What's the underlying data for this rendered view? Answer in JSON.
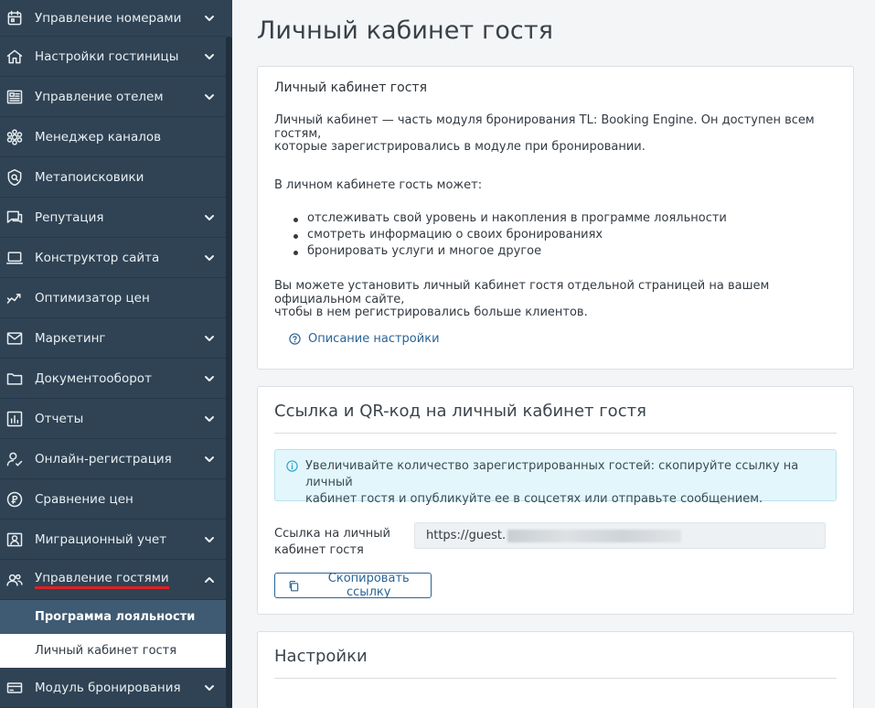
{
  "sidebar": {
    "items": [
      {
        "label": "Управление номерами",
        "icon": "calendar-icon"
      },
      {
        "label": "Настройки гостиницы",
        "icon": "home-icon"
      },
      {
        "label": "Управление отелем",
        "icon": "dashboard-icon"
      },
      {
        "label": "Менеджер каналов",
        "icon": "channels-icon"
      },
      {
        "label": "Метапоисковики",
        "icon": "search-shield-icon"
      },
      {
        "label": "Репутация",
        "icon": "chat-icon"
      },
      {
        "label": "Конструктор сайта",
        "icon": "laptop-icon"
      },
      {
        "label": "Оптимизатор цен",
        "icon": "trend-icon"
      },
      {
        "label": "Маркетинг",
        "icon": "mail-icon"
      },
      {
        "label": "Документооборот",
        "icon": "folder-icon"
      },
      {
        "label": "Отчеты",
        "icon": "bar-chart-icon"
      },
      {
        "label": "Онлайн-регистрация",
        "icon": "user-check-icon"
      },
      {
        "label": "Сравнение цен",
        "icon": "price-compare-icon"
      },
      {
        "label": "Миграционный учет",
        "icon": "id-card-icon"
      },
      {
        "label": "Управление гостями",
        "icon": "users-icon"
      },
      {
        "label": "Модуль бронирования",
        "icon": "card-icon"
      }
    ],
    "sub_items": [
      "Программа лояльности",
      "Личный кабинет гостя"
    ]
  },
  "page": {
    "title": "Личный кабинет гостя"
  },
  "intro_card": {
    "title": "Личный кабинет гостя",
    "p1_line1": "Личный кабинет — часть модуля бронирования TL: Booking Engine. Он доступен всем гостям,",
    "p1_line2": "которые зарегистрировались в модуле при бронировании.",
    "p2": "В личном кабинете гость может:",
    "bullets": [
      "отслеживать свой уровень и накопления в программе лояльности",
      "смотреть информацию о своих бронированиях",
      "бронировать услуги и многое другое"
    ],
    "p3_line1": "Вы можете установить личный кабинет гостя отдельной страницей на вашем официальном сайте,",
    "p3_line2": "чтобы в нем регистрировались больше клиентов.",
    "help_link": "Описание настройки"
  },
  "link_card": {
    "title": "Ссылка и QR-код на личный кабинет гостя",
    "info_line1": "Увеличивайте количество зарегистрированных гостей: скопируйте ссылку на личный",
    "info_line2": "кабинет гостя и опубликуйте ее в соцсетях или отправьте сообщением.",
    "field_label_line1": "Ссылка на личный",
    "field_label_line2": "кабинет гостя",
    "field_value": "https://guest.",
    "copy_button": "Скопировать ссылку"
  },
  "settings_card": {
    "title": "Настройки"
  },
  "colors": {
    "sidebar_bg": "#2f4354",
    "accent_link": "#2a6496",
    "active_underline": "#e02020",
    "info_bg": "#e3f6fb"
  }
}
